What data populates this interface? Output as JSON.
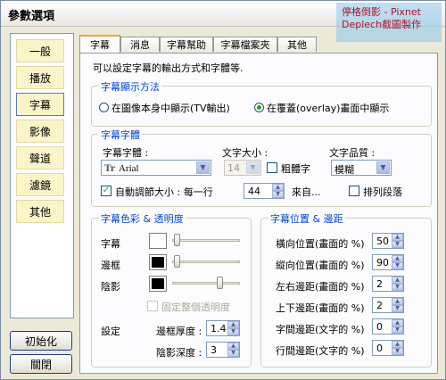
{
  "window": {
    "title": "參數選項"
  },
  "watermark": {
    "line1": "停格倒影 - Pixnet",
    "line2": "Deplech截圖製作"
  },
  "sidebar": {
    "items": [
      {
        "label": "一般",
        "active": false
      },
      {
        "label": "播放",
        "active": false
      },
      {
        "label": "字幕",
        "active": true
      },
      {
        "label": "影像",
        "active": false
      },
      {
        "label": "聲道",
        "active": false
      },
      {
        "label": "濾鏡",
        "active": false
      },
      {
        "label": "其他",
        "active": false
      }
    ],
    "reset_label": "初始化",
    "close_label": "關閉"
  },
  "tabs": [
    "字幕",
    "消息",
    "字幕幫助",
    "字幕檔案夾",
    "其他"
  ],
  "panel": {
    "description": "可以設定字幕的輸出方式和字體等.",
    "display_method": {
      "legend": "字幕顯示方法",
      "option1": "在圖像本身中顯示(TV輸出)",
      "option2": "在覆蓋(overlay)畫面中顯示",
      "selected": 2
    },
    "font": {
      "legend": "字幕字體",
      "font_label": "字幕字體 :",
      "font_value": "Arial",
      "size_label": "文字大小 :",
      "size_value": "14",
      "bold_label": "粗體字",
      "bold_checked": false,
      "quality_label": "文字品質 :",
      "quality_value": "模糊",
      "auto_size_label": "自動調節大小 : 每一行",
      "auto_size_checked": true,
      "chars_value": "44",
      "chars_suffix": "來自...",
      "arrange_label": "排列段落",
      "arrange_checked": false
    },
    "color": {
      "legend": "字幕色彩 & 透明度",
      "subtitle_label": "字幕",
      "border_label": "邊框",
      "shadow_label": "陰影",
      "subtitle_color": "#ffffff",
      "border_color": "#000000",
      "shadow_color": "#000000",
      "fixed_label": "固定整個透明度",
      "fixed_checked": false,
      "settings_label": "設定",
      "border_thickness_label": "邊框厚度 :",
      "border_thickness_value": "1.4",
      "shadow_depth_label": "陰影深度 :",
      "shadow_depth_value": "3"
    },
    "position": {
      "legend": "字幕位置 & 邊距",
      "rows": [
        {
          "label": "橫向位置(畫面的 %)",
          "value": "50"
        },
        {
          "label": "縱向位置(畫面的 %)",
          "value": "90"
        },
        {
          "label": "左右邊距(畫面的 %)",
          "value": "2"
        },
        {
          "label": "上下邊距(畫面的 %)",
          "value": "2"
        },
        {
          "label": "字間邊距(文字的 %)",
          "value": "0"
        },
        {
          "label": "行間邊距(文字的 %)",
          "value": "0"
        }
      ]
    }
  }
}
